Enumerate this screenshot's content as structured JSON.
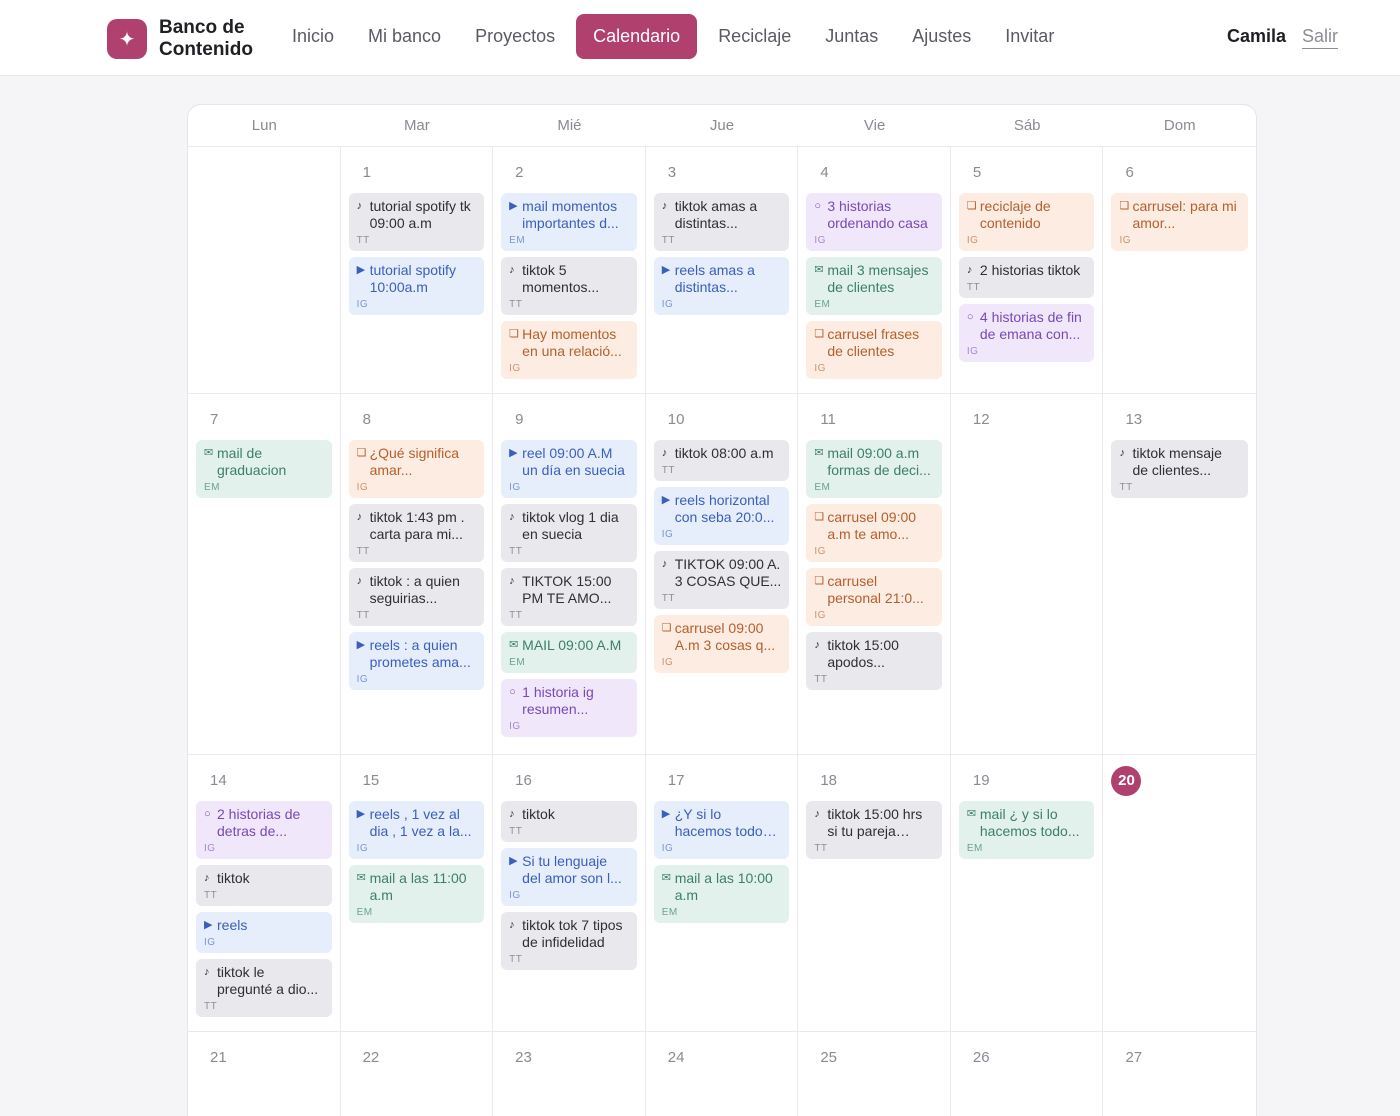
{
  "app": {
    "brand_line1": "Banco de",
    "brand_line2": "Contenido",
    "brand_icon": "sparkle-icon",
    "accent": "#b0416f"
  },
  "nav": {
    "items": [
      "Inicio",
      "Mi banco",
      "Proyectos",
      "Calendario",
      "Reciclaje",
      "Juntas",
      "Ajustes",
      "Invitar"
    ],
    "active": "Calendario"
  },
  "user": {
    "name": "Camila",
    "logout": "Salir"
  },
  "calendar": {
    "weekdays": [
      "Lun",
      "Mar",
      "Mié",
      "Jue",
      "Vie",
      "Sáb",
      "Dom"
    ],
    "today": "20",
    "weeks": [
      [
        {
          "num": "",
          "events": []
        },
        {
          "num": "1",
          "events": [
            {
              "type": "tt",
              "text": "tutorial spotify tk 09:00 a.m",
              "tag": "TT"
            },
            {
              "type": "ig",
              "text": "tutorial spotify 10:00a.m",
              "tag": "IG"
            }
          ]
        },
        {
          "num": "2",
          "events": [
            {
              "type": "em-blue",
              "text": "mail momentos importantes d...",
              "tag": "EM"
            },
            {
              "type": "tt",
              "text": "tiktok 5 momentos...",
              "tag": "TT"
            },
            {
              "type": "car",
              "text": "Hay momentos en una relació...",
              "tag": "IG"
            }
          ]
        },
        {
          "num": "3",
          "events": [
            {
              "type": "tt",
              "text": "tiktok amas a distintas...",
              "tag": "TT"
            },
            {
              "type": "ig",
              "text": "reels amas a distintas...",
              "tag": "IG"
            }
          ]
        },
        {
          "num": "4",
          "events": [
            {
              "type": "his",
              "text": "3 historias ordenando casa",
              "tag": "IG"
            },
            {
              "type": "em",
              "text": "mail 3 mensajes de clientes",
              "tag": "EM"
            },
            {
              "type": "car",
              "text": "carrusel frases de clientes",
              "tag": "IG"
            }
          ]
        },
        {
          "num": "5",
          "events": [
            {
              "type": "car",
              "text": "reciclaje de contenido",
              "tag": "IG"
            },
            {
              "type": "tt",
              "text": "2 historias tiktok",
              "tag": "TT"
            },
            {
              "type": "his",
              "text": "4 historias de fin de emana con...",
              "tag": "IG"
            }
          ]
        },
        {
          "num": "6",
          "events": [
            {
              "type": "car",
              "text": "carrusel: para mi amor...",
              "tag": "IG"
            }
          ]
        }
      ],
      [
        {
          "num": "7",
          "events": [
            {
              "type": "em",
              "text": "mail de graduacion",
              "tag": "EM"
            }
          ]
        },
        {
          "num": "8",
          "events": [
            {
              "type": "car",
              "text": "¿Qué significa amar...",
              "tag": "IG"
            },
            {
              "type": "tt",
              "text": "tiktok 1:43 pm . carta para mi...",
              "tag": "TT"
            },
            {
              "type": "tt",
              "text": "tiktok : a quien seguirias...",
              "tag": "TT"
            },
            {
              "type": "ig",
              "text": "reels : a quien prometes ama...",
              "tag": "IG"
            }
          ]
        },
        {
          "num": "9",
          "events": [
            {
              "type": "ig",
              "text": "reel 09:00 A.M un día en suecia",
              "tag": "IG"
            },
            {
              "type": "tt",
              "text": "tiktok vlog 1 dia en suecia",
              "tag": "TT"
            },
            {
              "type": "tt",
              "text": "TIKTOK 15:00 PM TE AMO...",
              "tag": "TT"
            },
            {
              "type": "em",
              "text": "MAIL 09:00 A.M",
              "tag": "EM"
            },
            {
              "type": "his",
              "text": "1 historia ig resumen...",
              "tag": "IG"
            }
          ]
        },
        {
          "num": "10",
          "events": [
            {
              "type": "tt",
              "text": "tiktok 08:00 a.m",
              "tag": "TT"
            },
            {
              "type": "ig",
              "text": "reels horizontal con seba 20:0...",
              "tag": "IG"
            },
            {
              "type": "tt",
              "text": "TIKTOK 09:00 A. 3 COSAS QUE...",
              "tag": "TT"
            },
            {
              "type": "car",
              "text": "carrusel 09:00 A.m 3 cosas q...",
              "tag": "IG"
            }
          ]
        },
        {
          "num": "11",
          "events": [
            {
              "type": "em",
              "text": "mail 09:00 a.m formas de deci...",
              "tag": "EM"
            },
            {
              "type": "car",
              "text": "carrusel 09:00 a.m te amo...",
              "tag": "IG"
            },
            {
              "type": "car",
              "text": "carrusel personal 21:0...",
              "tag": "IG"
            },
            {
              "type": "tt",
              "text": "tiktok 15:00 apodos...",
              "tag": "TT"
            }
          ]
        },
        {
          "num": "12",
          "events": []
        },
        {
          "num": "13",
          "events": [
            {
              "type": "tt",
              "text": "tiktok mensaje de clientes...",
              "tag": "TT"
            }
          ]
        }
      ],
      [
        {
          "num": "14",
          "events": [
            {
              "type": "his",
              "text": "2 historias de detras de...",
              "tag": "IG"
            },
            {
              "type": "tt",
              "text": "tiktok",
              "tag": "TT"
            },
            {
              "type": "ig",
              "text": "reels",
              "tag": "IG"
            },
            {
              "type": "tt",
              "text": "tiktok le pregunté a dio...",
              "tag": "TT"
            }
          ]
        },
        {
          "num": "15",
          "events": [
            {
              "type": "ig",
              "text": "reels , 1 vez al dia , 1 vez a la...",
              "tag": "IG"
            },
            {
              "type": "em",
              "text": "mail a las 11:00 a.m",
              "tag": "EM"
            }
          ]
        },
        {
          "num": "16",
          "events": [
            {
              "type": "tt",
              "text": "tiktok",
              "tag": "TT"
            },
            {
              "type": "ig",
              "text": "Si tu lenguaje del amor son l...",
              "tag": "IG"
            },
            {
              "type": "tt",
              "text": "tiktok tok 7 tipos de infidelidad",
              "tag": "TT"
            }
          ]
        },
        {
          "num": "17",
          "events": [
            {
              "type": "ig",
              "text": "¿Y si lo hacemos todos los días...",
              "tag": "IG"
            },
            {
              "type": "em",
              "text": "mail a las 10:00 a.m",
              "tag": "EM"
            }
          ]
        },
        {
          "num": "18",
          "events": [
            {
              "type": "tt",
              "text": "tiktok 15:00 hrs si tu pareja esta...",
              "tag": "TT"
            }
          ]
        },
        {
          "num": "19",
          "events": [
            {
              "type": "em",
              "text": "mail ¿ y si lo hacemos todo...",
              "tag": "EM"
            }
          ]
        },
        {
          "num": "20",
          "events": []
        }
      ],
      [
        {
          "num": "21",
          "events": []
        },
        {
          "num": "22",
          "events": []
        },
        {
          "num": "23",
          "events": []
        },
        {
          "num": "24",
          "events": []
        },
        {
          "num": "25",
          "events": []
        },
        {
          "num": "26",
          "events": []
        },
        {
          "num": "27",
          "events": []
        }
      ]
    ]
  }
}
